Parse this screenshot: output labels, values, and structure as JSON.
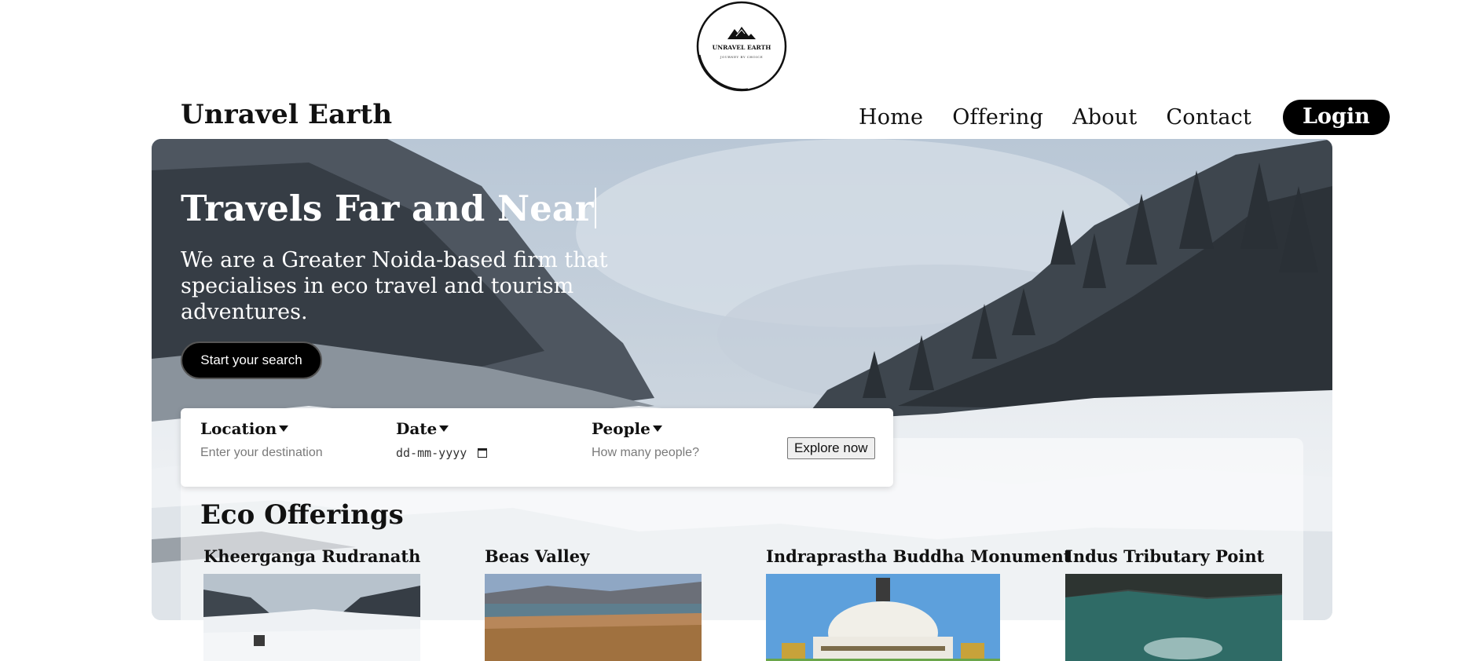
{
  "logo": {
    "name": "UNRAVEL EARTH",
    "tagline": "JOURNEY BY CHOICE"
  },
  "header": {
    "brand": "Unravel Earth",
    "nav": [
      "Home",
      "Offering",
      "About",
      "Contact"
    ],
    "login_label": "Login"
  },
  "hero": {
    "title": "Travels Far and Near",
    "subtitle": "We are a Greater Noida-based firm that specialises in eco travel and tourism adventures.",
    "cta_label": "Start your search"
  },
  "search": {
    "location": {
      "label": "Location",
      "placeholder": "Enter your destination"
    },
    "date": {
      "label": "Date",
      "value": "dd-mm-yyyy"
    },
    "people": {
      "label": "People",
      "placeholder": "How many people?"
    },
    "explore_label": "Explore now"
  },
  "offerings": {
    "title": "Eco Offerings",
    "cards": [
      {
        "title": "Kheerganga Rudranath"
      },
      {
        "title": "Beas Valley"
      },
      {
        "title": "Indraprastha Buddha Monument"
      },
      {
        "title": "Indus Tributary Point"
      }
    ]
  },
  "colors": {
    "accent": "#000000",
    "background": "#ffffff",
    "hero_text": "#ffffff"
  }
}
